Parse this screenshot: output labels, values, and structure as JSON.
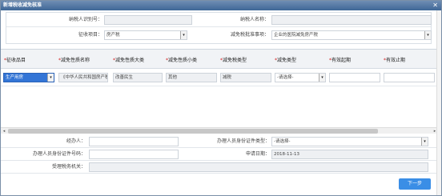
{
  "window": {
    "title": "新增税收减免核准",
    "close_glyph": "✕"
  },
  "top_form": {
    "taxpayer_id_label": "纳税人识别号：",
    "taxpayer_id_value": "",
    "taxpayer_name_label": "纳税人名称：",
    "taxpayer_name_value": "",
    "levy_item_label": "征收项目：",
    "levy_item_value": "房产税",
    "relief_basis_label": "减免税批准事项：",
    "relief_basis_value": "企业的医院减免房产税"
  },
  "grid": {
    "headers": [
      {
        "star": "*",
        "text": "征收品目"
      },
      {
        "star": "*",
        "text": "减免性质名称"
      },
      {
        "star": "*",
        "text": "减免性质大类"
      },
      {
        "star": "*",
        "text": "减免性质小类"
      },
      {
        "star": "*",
        "text": "减免税类型"
      },
      {
        "star": "*",
        "text": "减免类型"
      },
      {
        "star": "*",
        "text": "有效起期"
      },
      {
        "star": "*",
        "text": "有效止期"
      }
    ],
    "row": {
      "levy_item": "生产用房",
      "relief_name": "《中华人民共和国房产税",
      "relief_major": "改善民生",
      "relief_minor": "其他",
      "relief_tax_type": "减税",
      "relief_type": "-请选择-",
      "valid_from": "",
      "valid_to": ""
    }
  },
  "bottom_form": {
    "agent_label": "经办人：",
    "agent_value": "",
    "agent_id_type_label": "办理人员身份证件类型：",
    "agent_id_type_value": "-请选择-",
    "agent_id_no_label": "办理人员身份证件号码：",
    "agent_id_no_value": "",
    "apply_date_label": "申请日期：",
    "apply_date_value": "2018-11-13",
    "tax_office_label": "受理税务机关：",
    "tax_office_value": ""
  },
  "buttons": {
    "next": "下一步"
  },
  "scroll": {
    "left_glyph": "◂",
    "right_glyph": "▸",
    "dropdown_glyph": "▾"
  }
}
